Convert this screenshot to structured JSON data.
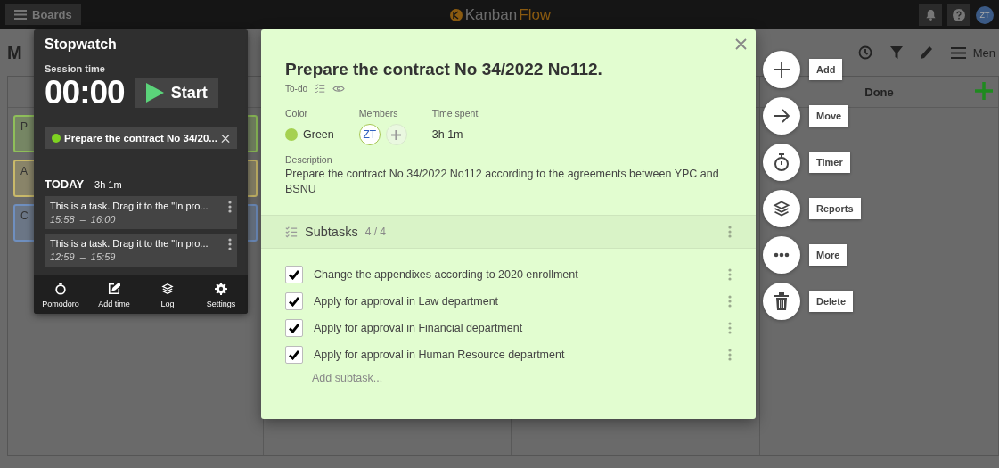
{
  "top_bar": {
    "boards_button": "Boards",
    "logo_part_1": "Kanban",
    "logo_part_2": "Flow",
    "avatar": "ZT"
  },
  "board": {
    "title_fragment": "M",
    "menu_label": "Men",
    "done_column": "Done",
    "cards": [
      {
        "letter": "P",
        "color": "#8fbf5a"
      },
      {
        "letter": "A",
        "color": "#c9b96a"
      },
      {
        "letter": "C",
        "color": "#6f8fbf"
      }
    ]
  },
  "stopwatch": {
    "title": "Stopwatch",
    "session_label": "Session time",
    "time": "00:00",
    "start_button": "Start",
    "current_task": {
      "title": "Prepare the contract No 34/20...",
      "color": "#7ed321"
    },
    "today_label": "TODAY",
    "today_total": "3h 1m",
    "entries": [
      {
        "title": "This is a task. Drag it to the \"In pro...",
        "time_range": "15:58  –  16:00"
      },
      {
        "title": "This is a task. Drag it to the \"In pro...",
        "time_range": "12:59  –  15:59"
      }
    ],
    "footer": [
      {
        "kind": "pomodoro",
        "label": "Pomodoro"
      },
      {
        "kind": "add-time",
        "label": "Add time"
      },
      {
        "kind": "log",
        "label": "Log"
      },
      {
        "kind": "settings",
        "label": "Settings"
      }
    ]
  },
  "task": {
    "title": "Prepare the contract No 34/2022 No112.",
    "column": "To-do",
    "color_label": "Color",
    "color": {
      "name": "Green",
      "color": "#a5d150"
    },
    "members_label": "Members",
    "members": [
      {
        "initials": "ZT"
      }
    ],
    "time_spent_label": "Time spent",
    "time_spent": "3h 1m",
    "description_label": "Description",
    "description": "Prepare the contract No 34/2022 No112 according to the agreements between YPC and BSNU",
    "subtasks": {
      "title": "Subtasks",
      "count": "4 / 4",
      "items": [
        {
          "text": "Change the appendixes according to 2020 enrollment",
          "checked": true
        },
        {
          "text": "Apply for approval in Law department",
          "checked": true
        },
        {
          "text": "Apply for approval in Financial department",
          "checked": true
        },
        {
          "text": "Apply for approval in Human Resource department",
          "checked": true
        }
      ],
      "add_placeholder": "Add subtask..."
    }
  },
  "actions": [
    {
      "kind": "add",
      "label": "Add"
    },
    {
      "kind": "move",
      "label": "Move"
    },
    {
      "kind": "timer",
      "label": "Timer"
    },
    {
      "kind": "reports",
      "label": "Reports"
    },
    {
      "kind": "more",
      "label": "More"
    },
    {
      "kind": "delete",
      "label": "Delete"
    }
  ]
}
